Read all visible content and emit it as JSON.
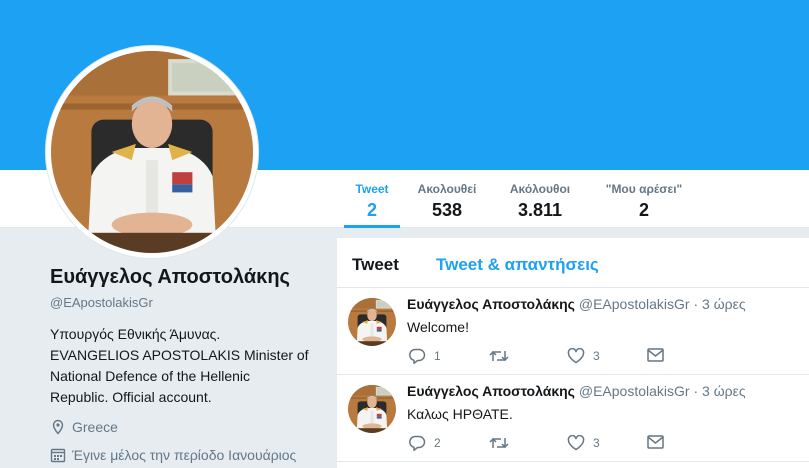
{
  "profile": {
    "name": "Ευάγγελος Αποστολάκης",
    "handle": "@EApostolakisGr",
    "bio": "Υπουργός Εθνικής Άμυνας. EVANGELIOS APOSTOLAKIS Minister of National Defence of the Hellenic Republic. Official account.",
    "location": "Greece",
    "joined": "Έγινε μέλος την περίοδο Ιανουάριος"
  },
  "stats": [
    {
      "label": "Tweet",
      "value": "2"
    },
    {
      "label": "Ακολουθεί",
      "value": "538"
    },
    {
      "label": "Ακόλουθοι",
      "value": "3.811"
    },
    {
      "label": "\"Μου αρέσει\"",
      "value": "2"
    }
  ],
  "timeline": {
    "tabs": [
      "Tweet",
      "Tweet & απαντήσεις"
    ]
  },
  "tweets": [
    {
      "name": "Ευάγγελος Αποστολάκης",
      "handle": "@EApostolakisGr",
      "dot": "·",
      "time": "3 ώρες",
      "text": "Welcome!",
      "replies": "1",
      "retweets": "",
      "likes": "3"
    },
    {
      "name": "Ευάγγελος Αποστολάκης",
      "handle": "@EApostolakisGr",
      "dot": "·",
      "time": "3 ώρες",
      "text": "Καλως ΗΡΘΑΤΕ.",
      "replies": "2",
      "retweets": "",
      "likes": "3"
    }
  ],
  "colors": {
    "accent": "#1da1f2",
    "banner": "#1da1f2",
    "muted": "#657786"
  },
  "icons": [
    "location-icon",
    "calendar-icon",
    "reply-icon",
    "retweet-icon",
    "like-icon",
    "message-icon"
  ]
}
